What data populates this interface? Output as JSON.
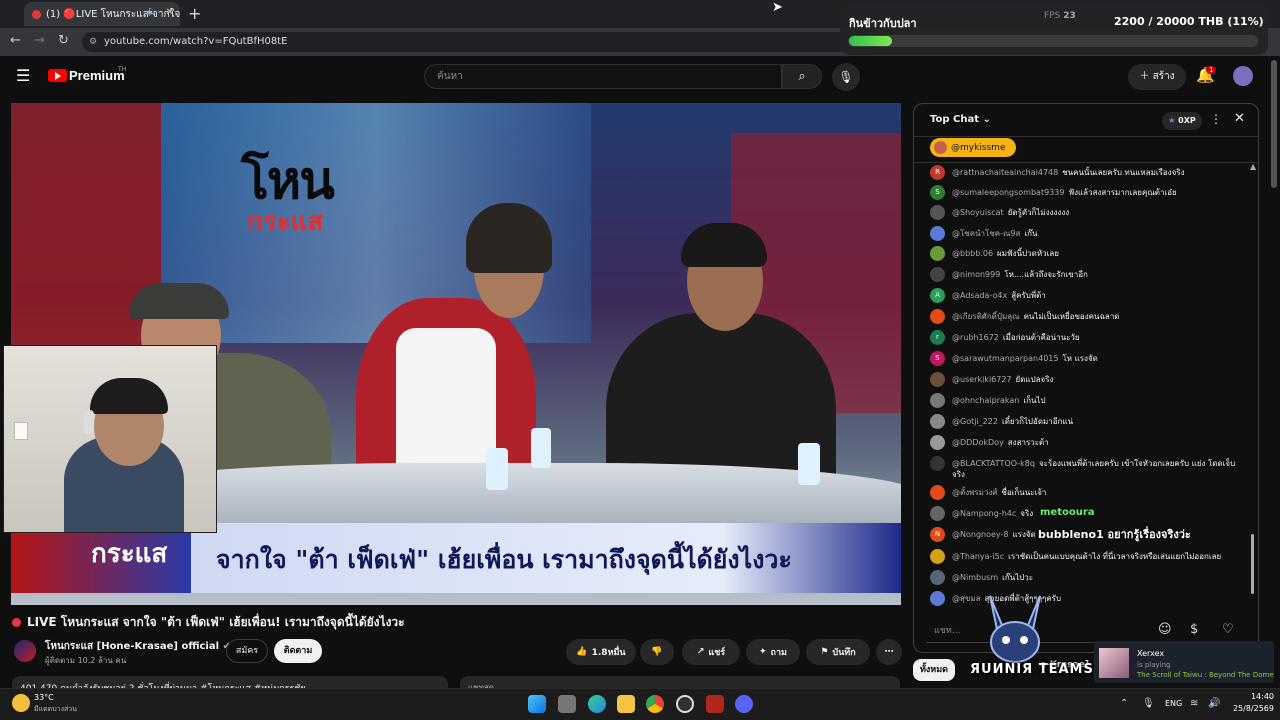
{
  "browser": {
    "tab_title": "(1) 🔴LIVE โหนกระแส จากใจ",
    "new_tab_icon": "+",
    "url": "youtube.com/watch?v=FQutBfH08tE"
  },
  "header": {
    "logo_text": "Premium",
    "logo_sup": "TH",
    "search_placeholder": "ค้นหา",
    "create_label": "สร้าง",
    "notif_count": "1"
  },
  "video": {
    "show_logo": "โหน",
    "show_logo2": "กระแส",
    "lower_third_logo": "กระแส",
    "lower_third": "จากใจ \"ต้า เฟ็ดเฟ่\" เฮ้ยเพื่อน เรามาถึงจุดนี้ได้ยังไงวะ",
    "title": "LIVE โหนกระแส จากใจ \"ต้า เฟ็ดเฟ่\" เฮ้ยเพื่อน! เรามาถึงจุดนี้ได้ยังไงวะ",
    "channel": "โหนกระแส [Hone-Krasae] official",
    "subscribers": "ผู้ติดตาม 10.2 ล้าน คน",
    "join_label": "สมัคร",
    "subscribe_label": "ติดตาม",
    "likes": "1.8หมื่น",
    "share_label": "แชร์",
    "ask_label": "ถาม",
    "save_label": "บันทึก",
    "views_line": "401,470 คนกำลังรับชมอยู่ 2 ชั่วโมงที่ผ่านมา #โหนกระแส #หนุ่มกรรชัย",
    "side_desc": "แชทสด"
  },
  "chat": {
    "title": "Top Chat",
    "xp": "0XP",
    "pinned_user": "@mykissme",
    "input_placeholder": "แชท...",
    "messages": [
      {
        "user": "@rattnachaiteainchai4748",
        "text": "ชนคนนั้นเลยครับ ทนแหลมเรืองจริง",
        "color": "#c0392b",
        "initial": "R"
      },
      {
        "user": "@sumaleepongsombat9339",
        "text": "ฟังแล้วสงสารมากเลยคุณต้าเอ๋ย",
        "color": "#2e7d32",
        "initial": "S"
      },
      {
        "user": "@Shoyuiscat",
        "text": "ยัดรู้ตัวก็ไม่งงงงงง",
        "color": "#555555",
        "initial": ""
      },
      {
        "user": "@โชคนำโชค-ณ9ส",
        "text": "เก๊น",
        "color": "#5c7bd6",
        "initial": ""
      },
      {
        "user": "@bbbb.06",
        "text": "ผมฟังนี้ปวดหัวเลย",
        "color": "#6a9a3a",
        "initial": ""
      },
      {
        "user": "@nimon999",
        "text": "โห....แล้วถึงจะรักเขาอีก",
        "color": "#444444",
        "initial": ""
      },
      {
        "user": "@Adsada-o4x",
        "text": "สู้ครับพี่ต้า",
        "color": "#2e9d5a",
        "initial": "A"
      },
      {
        "user": "@เกียรติศักดิ์ปุ๋มลุณ",
        "text": "คนไม่เป็นเหยื่อของคนฉลาด",
        "color": "#e64a19",
        "initial": ""
      },
      {
        "user": "@rubh1672",
        "text": "เมื่อก่อนต้าคือน่านะวัย",
        "color": "#1b7d4f",
        "initial": "r"
      },
      {
        "user": "@sarawutmanparpan4015",
        "text": "โห แรงจัด",
        "color": "#c2185b",
        "initial": "S"
      },
      {
        "user": "@userkiki6727",
        "text": "ยัดแปลจริง",
        "color": "#6b4f3a",
        "initial": ""
      },
      {
        "user": "@ohnchaiprakan",
        "text": "เก็นไป",
        "color": "#777777",
        "initial": ""
      },
      {
        "user": "@Gotji_222",
        "text": "เดี๋ยวก็ไปอัดมาอีกแน่",
        "color": "#888888",
        "initial": ""
      },
      {
        "user": "@DDDokDoy",
        "text": "สงสารวะต้า",
        "color": "#999999",
        "initial": ""
      },
      {
        "user": "@BLACKTATTOO-k8q",
        "text": "จะร้องแพนพี่ต้าเลยครับ เข้าใจหัวอกเลยครับ แย่ง โดดเจ็บจริง",
        "color": "#333333",
        "initial": ""
      },
      {
        "user": "@ตั้งพรมวงศ์",
        "text": "ชื่อเก็นนะเจ้า",
        "color": "#e64a19",
        "initial": ""
      },
      {
        "user": "@Nampong-h4c",
        "text": "จริง",
        "color": "#666666",
        "initial": ""
      },
      {
        "user": "@Nongnoey-8",
        "text": "แรงจัด",
        "color": "#e64a19",
        "initial": "N"
      },
      {
        "user": "@Thanya-i5c",
        "text": "เราชัดเป็นคนแบบคุณต้าไง ที่นี่เวลาจริงหรือเล่นแยกไม่ออกเลย",
        "color": "#d4a017",
        "initial": ""
      },
      {
        "user": "@Nimbusm",
        "text": "เก๊นไปวะ",
        "color": "#556677",
        "initial": ""
      },
      {
        "user": "@สุขมล",
        "text": "สุดยอดพี่ต้าสู้ๆๆๆๆครับ",
        "color": "#5c7bd6",
        "initial": ""
      }
    ]
  },
  "overlay": {
    "goal_title": "กินข้าวกับปลา",
    "goal_amount": "2200 / 20000 THB (11%)",
    "goal_fraction": 0.11,
    "fps_label": "FPS",
    "fps_value": "23",
    "floating1": "metooura",
    "floating2": "bubbleno1  อยากรู้เรื่องจริงว่ะ",
    "mascot_text": "ЯUИNIЯ TEAMS",
    "all_chip": "ทั้งหมด",
    "krasae_chip": "e-Krasae]",
    "steam_name": "Xerxex",
    "steam_playing": "is playing",
    "steam_game": "The Scroll of Taiwu : Beyond The Dome"
  },
  "taskbar": {
    "temp": "33°C",
    "weather_desc": "มีแดดบางส่วน",
    "lang": "ENG",
    "time": "14:40",
    "date": "25/8/2569"
  },
  "colors": {
    "yt_red": "#ff0000",
    "goal_green": "#35c04a",
    "pinned_gold": "#f5b414"
  }
}
